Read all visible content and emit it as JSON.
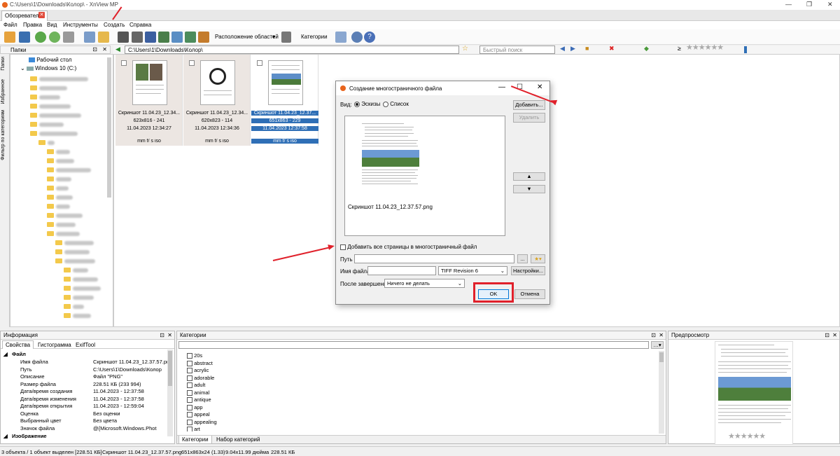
{
  "window": {
    "title": "C:\\Users\\1\\Downloads\\Колор\\ - XnView MP"
  },
  "tab": {
    "label": "Обозреватель"
  },
  "menu": [
    "Файл",
    "Правка",
    "Вид",
    "Инструменты",
    "Создать",
    "Справка"
  ],
  "toolbar": {
    "layout_label": "Расположение областей",
    "categories_label": "Категории"
  },
  "left_panel": {
    "title": "Папки",
    "vtabs": [
      "Папки",
      "Избранное",
      "Фильтр по категориям"
    ],
    "tree": [
      {
        "label": "Рабочий стол"
      },
      {
        "label": "Windows 10 (C:)"
      }
    ]
  },
  "address": {
    "path": "C:\\Users\\1\\Downloads\\Колор\\",
    "search_placeholder": "Быстрый поиск"
  },
  "thumbnails": [
    {
      "name": "Скриншот 11.04.23_12.34...",
      "size": "623x816 - 241",
      "date": "11.04.2023 12:34:27",
      "exif": "mm f/ s iso",
      "selected": false
    },
    {
      "name": "Скриншот 11.04.23_12.34...",
      "size": "620x823 - 114",
      "date": "11.04.2023 12:34:36",
      "exif": "mm f/ s iso",
      "selected": false
    },
    {
      "name": "Скриншот 11.04.23_12.37...",
      "size": "651x863 - 229",
      "date": "11.04.2023 12:37:58",
      "exif": "mm f/ s iso",
      "selected": true
    }
  ],
  "dialog": {
    "title": "Создание многостраничного файла",
    "view_label": "Вид:",
    "view_options": [
      "Эскизы",
      "Список"
    ],
    "add_button": "Добавить...",
    "remove_button": "Удалить",
    "preview_filename": "Скриншот 11.04.23_12.37.57.png",
    "all_pages_checkbox": "Добавить все страницы в многостраничный файл",
    "path_label": "Путь",
    "path_value": "",
    "browse_button": "...",
    "filename_label": "Имя файла",
    "filename_value": "",
    "format_value": "TIFF Revision 6",
    "settings_button": "Настройки...",
    "after_label": "После завершения",
    "after_value": "Ничего не делать",
    "ok_button": "OK",
    "cancel_button": "Отмена"
  },
  "info_panel": {
    "title": "Информация",
    "tabs": [
      "Свойства",
      "Гистограмма",
      "ExifTool"
    ],
    "section": "Файл",
    "rows": [
      {
        "k": "Имя файла",
        "v": "Скриншот 11.04.23_12.37.57.png"
      },
      {
        "k": "Путь",
        "v": "C:\\Users\\1\\Downloads\\Колор"
      },
      {
        "k": "Описание",
        "v": "Файл \"PNG\""
      },
      {
        "k": "Размер файла",
        "v": "228.51 КБ (233 994)"
      },
      {
        "k": "Дата/время создания",
        "v": "11.04.2023 - 12:37:58"
      },
      {
        "k": "Дата/время изменения",
        "v": "11.04.2023 - 12:37:58"
      },
      {
        "k": "Дата/время открытия",
        "v": "11.04.2023 - 12:59:04"
      },
      {
        "k": "Оценка",
        "v": "Без оценки"
      },
      {
        "k": "Выбранный цвет",
        "v": "Без цвета"
      },
      {
        "k": "Значок файла",
        "v": "@{Microsoft.Windows.Phot"
      }
    ],
    "next_section": "Изображение"
  },
  "categories_panel": {
    "title": "Категории",
    "items": [
      "20s",
      "abstract",
      "acrylic",
      "adorable",
      "adult",
      "animal",
      "antique",
      "app",
      "appeal",
      "appealing",
      "art"
    ],
    "tabs": [
      "Категории",
      "Набор категорий"
    ]
  },
  "preview_panel": {
    "title": "Предпросмотр"
  },
  "status": {
    "objects": "3 объекта / 1 объект выделен [228.51 КБ]",
    "file": "Скриншот 11.04.23_12.37.57.png",
    "dims": "651x863x24 (1.33)",
    "inches": "9.04x11.99 дюйма",
    "size": "228.51 КБ"
  },
  "colors": {
    "accent": "#2f6fb6",
    "annotation": "#e0202a",
    "folder": "#f3c94b"
  }
}
